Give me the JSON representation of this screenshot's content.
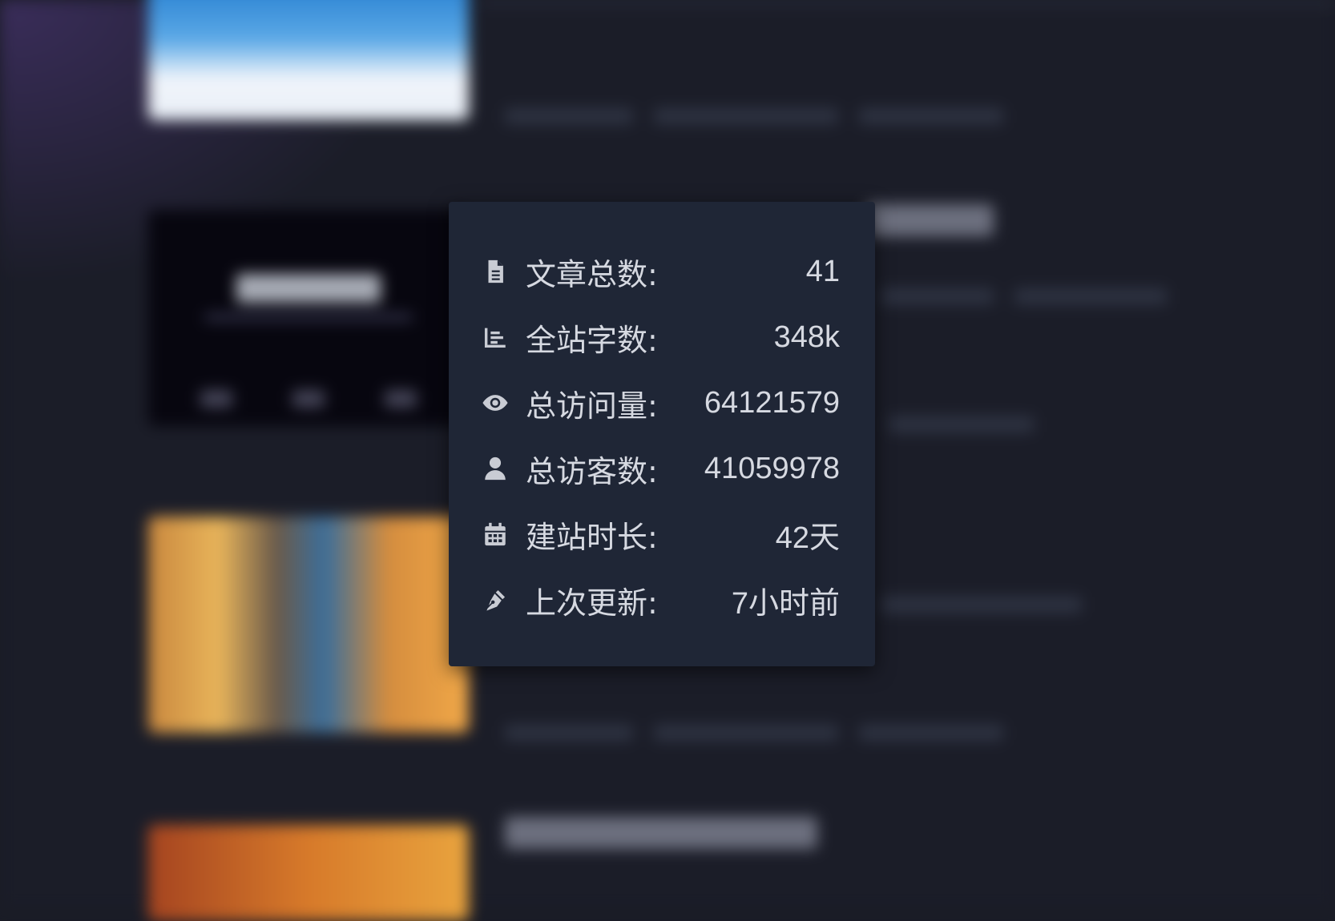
{
  "stats": {
    "items": [
      {
        "icon": "file-text-icon",
        "label": "文章总数:",
        "value": "41"
      },
      {
        "icon": "bar-chart-icon",
        "label": "全站字数:",
        "value": "348k"
      },
      {
        "icon": "eye-icon",
        "label": "总访问量:",
        "value": "64121579"
      },
      {
        "icon": "user-icon",
        "label": "总访客数:",
        "value": "41059978"
      },
      {
        "icon": "calendar-icon",
        "label": "建站时长:",
        "value": "42天"
      },
      {
        "icon": "pen-icon",
        "label": "上次更新:",
        "value": "7小时前"
      }
    ]
  },
  "colors": {
    "page_background": "#1a1c26",
    "popup_background": "#1f2636",
    "text": "#d6d9e1",
    "icon": "#c9ccd4"
  }
}
